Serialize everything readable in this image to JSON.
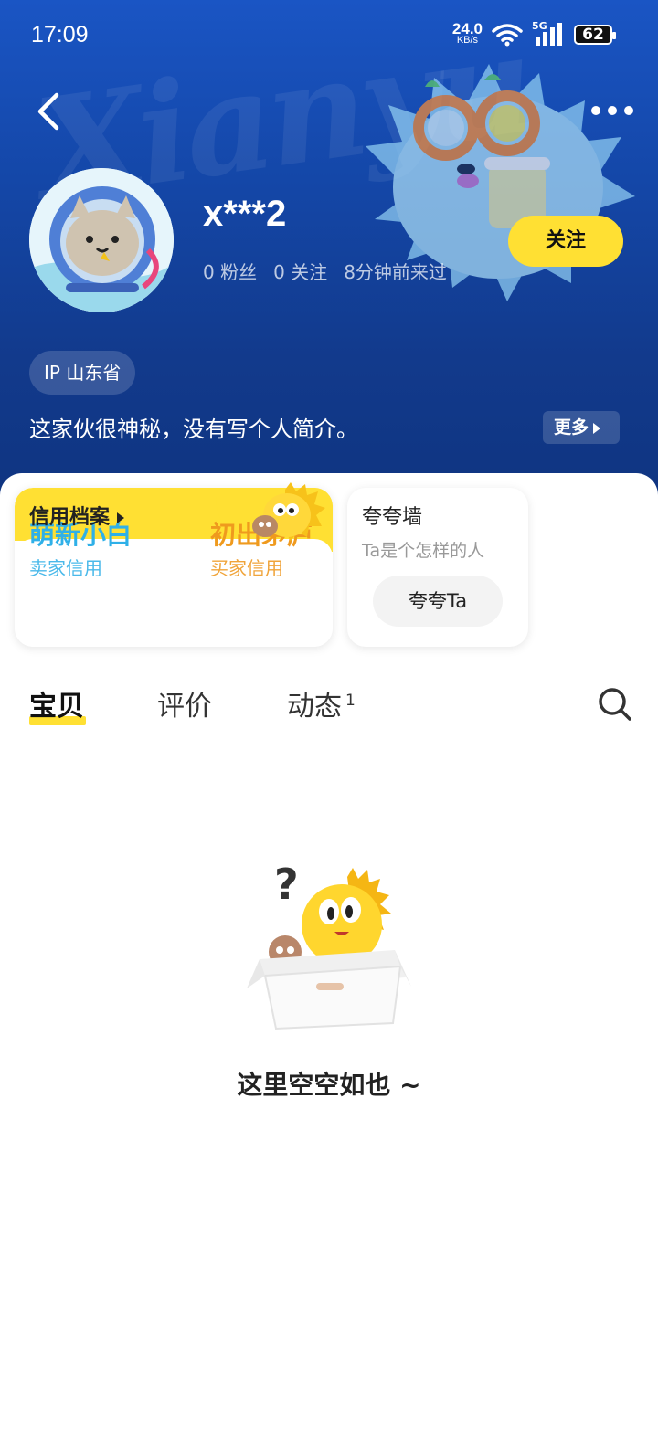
{
  "status_bar": {
    "time": "17:09",
    "net_speed_value": "24.0",
    "net_speed_unit": "KB/s",
    "network_type": "5G",
    "battery": "62"
  },
  "header": {
    "background_script": "Xianyu",
    "username": "x***2",
    "stats": {
      "fans": "0 粉丝",
      "following": "0 关注",
      "last_seen": "8分钟前来过"
    },
    "follow_label": "关注",
    "ip_location": "IP 山东省",
    "bio": "这家伙很神秘，没有写个人简介。",
    "more_label": "更多",
    "accent_color": "#ffe033"
  },
  "credit": {
    "title": "信用档案",
    "seller_level": "萌新小白",
    "seller_label": "卖家信用",
    "buyer_level": "初出茅庐",
    "buyer_label": "买家信用"
  },
  "praise": {
    "title": "夸夸墙",
    "subtitle": "Ta是个怎样的人",
    "button_label": "夸夸Ta"
  },
  "tabs": [
    {
      "label": "宝贝",
      "active": true
    },
    {
      "label": "评价",
      "active": false
    },
    {
      "label": "动态",
      "badge": "1",
      "active": false
    }
  ],
  "empty_state": {
    "text": "这里空空如也 ~"
  },
  "icons": {
    "back": "back-arrow-icon",
    "more": "more-dots-icon",
    "search": "search-icon",
    "wifi": "wifi-icon",
    "signal": "signal-icon",
    "battery": "battery-icon"
  }
}
